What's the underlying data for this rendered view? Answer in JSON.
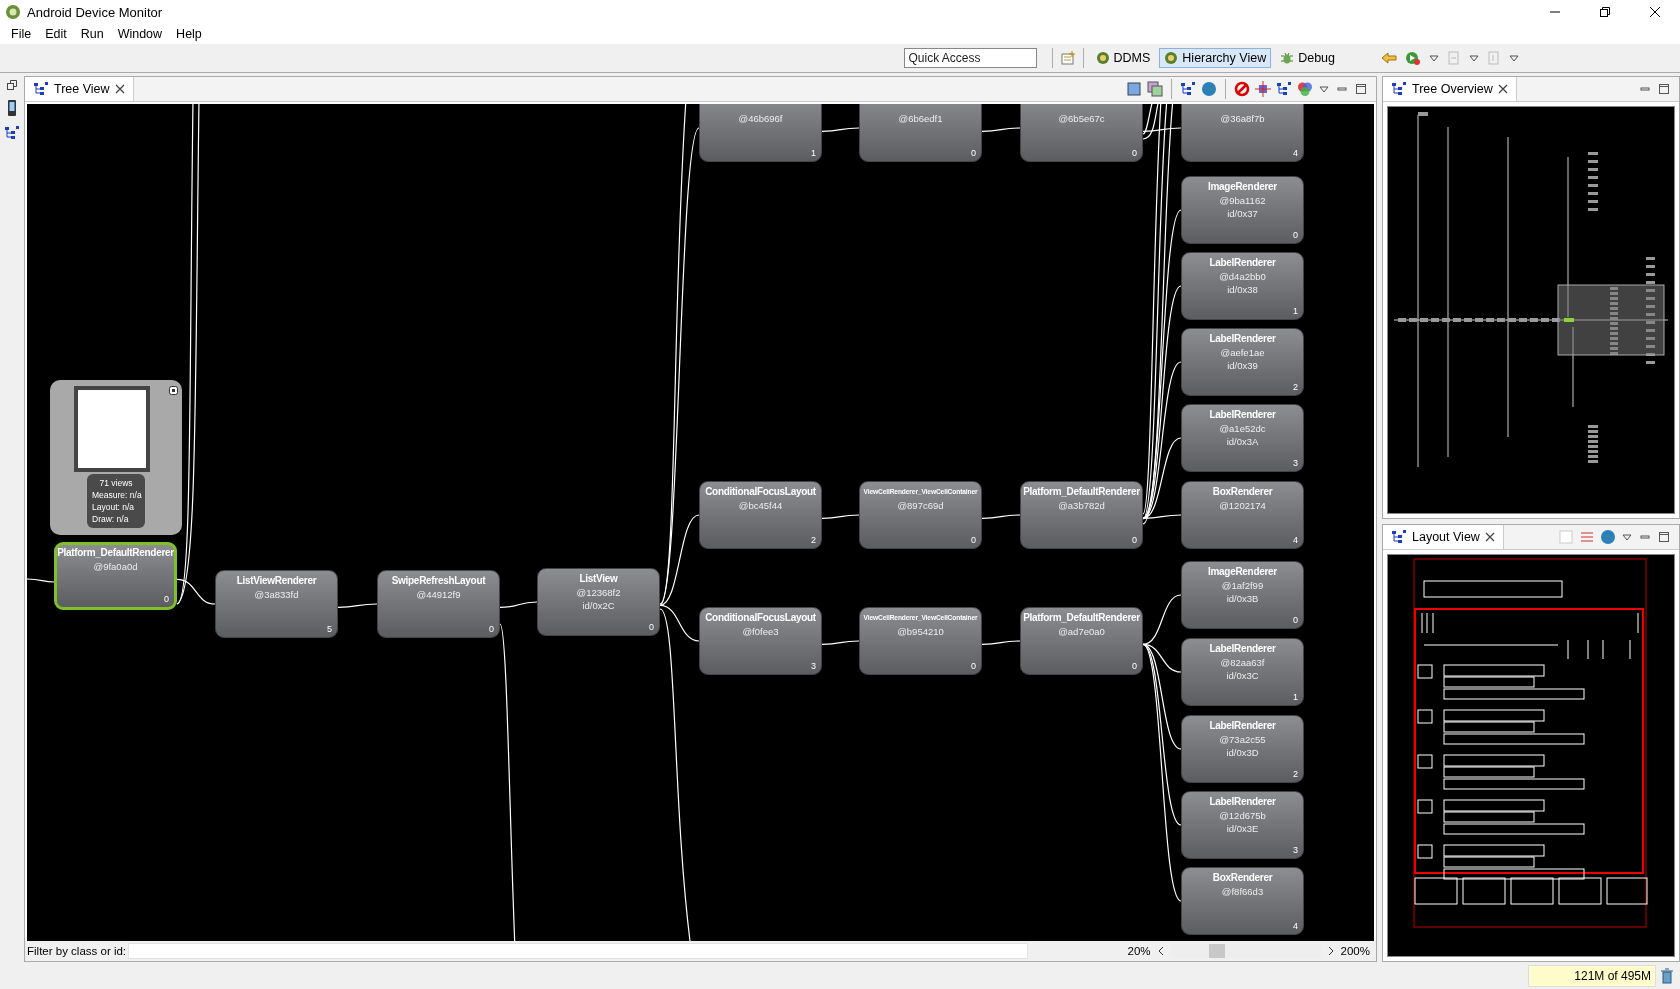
{
  "window": {
    "title": "Android Device Monitor"
  },
  "menu": [
    "File",
    "Edit",
    "Run",
    "Window",
    "Help"
  ],
  "toolbar": {
    "quick_access": {
      "placeholder": "Quick Access"
    },
    "perspectives": [
      {
        "label": "DDMS",
        "selected": false
      },
      {
        "label": "Hierarchy View",
        "selected": true
      },
      {
        "label": "Debug",
        "selected": false
      }
    ]
  },
  "tree_view": {
    "tab": "Tree View",
    "root": {
      "name": "Platform_DefaultRenderer",
      "hash": "@9fa0a0d",
      "index": "0",
      "selected": true,
      "children": [
        {
          "name": "ListViewRenderer",
          "hash": "@3a833fd",
          "index": "5",
          "selected": false,
          "children": [
            {
              "name": "SwipeRefreshLayout",
              "hash": "@44912f9",
              "index": "0",
              "selected": false,
              "children": [
                {
                  "name": "ListView",
                  "hash": "@12368f2",
                  "view_id": "id/0x2C",
                  "index": "0",
                  "selected": false,
                  "children": [
                    {
                      "hash": "@46b696f",
                      "index": "1",
                      "selected": false,
                      "children": [
                        {
                          "hash": "@6b6edf1",
                          "index": "0",
                          "selected": false,
                          "children": [
                            {
                              "hash": "@6b5e67c",
                              "index": "0",
                              "selected": false,
                              "children": [
                                {
                                  "hash": "@36a8f7b",
                                  "index": "4",
                                  "selected": false
                                }
                              ]
                            }
                          ]
                        }
                      ]
                    },
                    {
                      "name": "ConditionalFocusLayout",
                      "hash": "@bc45f44",
                      "index": "2",
                      "selected": false,
                      "children": [
                        {
                          "name": "ViewCellRenderer_ViewCellContainer",
                          "hash": "@897c69d",
                          "index": "0",
                          "selected": false,
                          "children": [
                            {
                              "name": "Platform_DefaultRenderer",
                              "hash": "@a3b782d",
                              "index": "0",
                              "selected": false,
                              "children": [
                                {
                                  "name": "ImageRenderer",
                                  "hash": "@9ba1162",
                                  "view_id": "id/0x37",
                                  "index": "0",
                                  "selected": false
                                },
                                {
                                  "name": "LabelRenderer",
                                  "hash": "@d4a2bb0",
                                  "view_id": "id/0x38",
                                  "index": "1",
                                  "selected": false
                                },
                                {
                                  "name": "LabelRenderer",
                                  "hash": "@aefe1ae",
                                  "view_id": "id/0x39",
                                  "index": "2",
                                  "selected": false
                                },
                                {
                                  "name": "LabelRenderer",
                                  "hash": "@a1e52dc",
                                  "view_id": "id/0x3A",
                                  "index": "3",
                                  "selected": false
                                },
                                {
                                  "name": "BoxRenderer",
                                  "hash": "@1202174",
                                  "index": "4",
                                  "selected": false
                                }
                              ]
                            }
                          ]
                        }
                      ]
                    },
                    {
                      "name": "ConditionalFocusLayout",
                      "hash": "@f0fee3",
                      "index": "3",
                      "selected": false,
                      "children": [
                        {
                          "name": "ViewCellRenderer_ViewCellContainer",
                          "hash": "@b954210",
                          "index": "0",
                          "selected": false,
                          "children": [
                            {
                              "name": "Platform_DefaultRenderer",
                              "hash": "@ad7e0a0",
                              "index": "0",
                              "selected": false,
                              "children": [
                                {
                                  "name": "ImageRenderer",
                                  "hash": "@1af2f99",
                                  "view_id": "id/0x3B",
                                  "index": "0",
                                  "selected": false
                                },
                                {
                                  "name": "LabelRenderer",
                                  "hash": "@82aa63f",
                                  "view_id": "id/0x3C",
                                  "index": "1",
                                  "selected": false
                                },
                                {
                                  "name": "LabelRenderer",
                                  "hash": "@73a2c55",
                                  "view_id": "id/0x3D",
                                  "index": "2",
                                  "selected": false
                                },
                                {
                                  "name": "LabelRenderer",
                                  "hash": "@12d675b",
                                  "view_id": "id/0x3E",
                                  "index": "3",
                                  "selected": false
                                },
                                {
                                  "name": "BoxRenderer",
                                  "hash": "@f8f66d3",
                                  "index": "4",
                                  "selected": false
                                }
                              ]
                            }
                          ]
                        }
                      ]
                    }
                  ]
                }
              ]
            }
          ]
        }
      ]
    },
    "popup": {
      "lines": [
        "71 views",
        "Measure: n/a",
        "Layout: n/a",
        "Draw: n/a"
      ]
    },
    "filter": {
      "label": "Filter by class or id:"
    },
    "zoom": {
      "min": "20%",
      "max": "200%",
      "level": 0.31
    }
  },
  "tree_overview": {
    "tab": "Tree Overview"
  },
  "layout_view": {
    "tab": "Layout View"
  },
  "status_bar": {
    "memory": "121M of 495M"
  }
}
